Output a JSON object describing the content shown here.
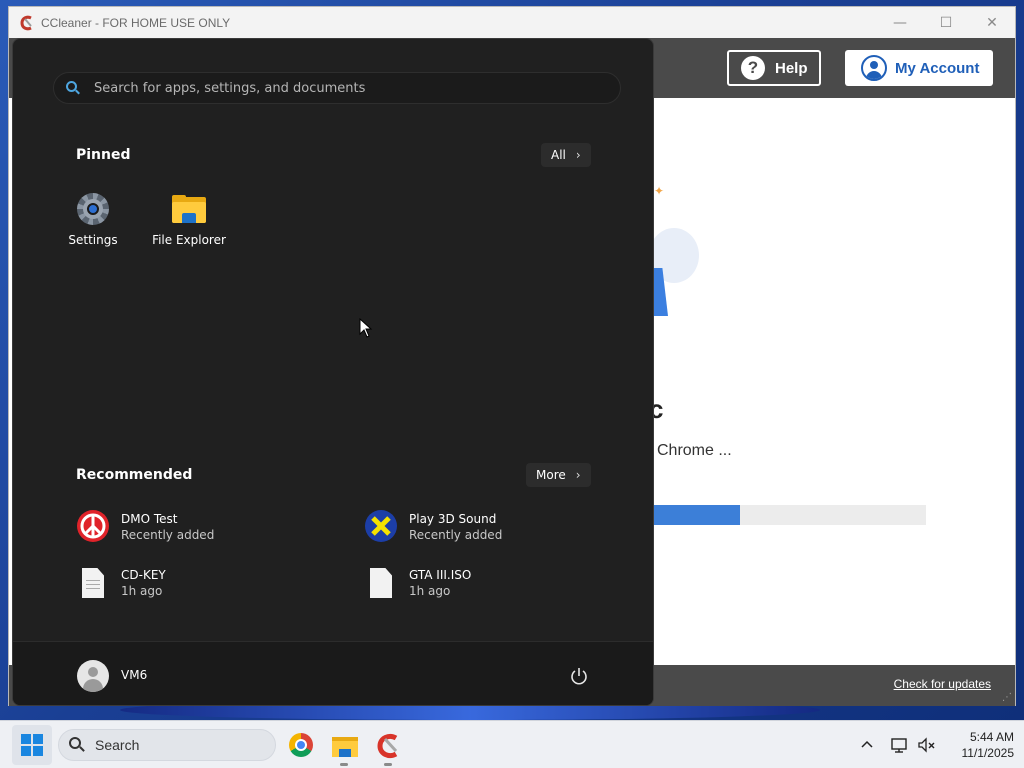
{
  "app_window": {
    "title": "CCleaner - FOR HOME USE ONLY",
    "controls": {
      "minimize": "—",
      "maximize": "☐",
      "close": "✕"
    },
    "header": {
      "help_label": "Help",
      "account_label": "My Account"
    },
    "content": {
      "partial_heading": "c",
      "status_text": "Chrome ...",
      "progress_fraction": 0.33
    },
    "footer": {
      "check_updates_label": "Check for updates"
    }
  },
  "start_menu": {
    "search_placeholder": "Search for apps, settings, and documents",
    "pinned": {
      "title": "Pinned",
      "all_label": "All",
      "apps": [
        {
          "label": "Settings",
          "icon": "gear-icon"
        },
        {
          "label": "File Explorer",
          "icon": "folder-icon"
        }
      ]
    },
    "recommended": {
      "title": "Recommended",
      "more_label": "More",
      "items": [
        {
          "name": "DMO Test",
          "sub": "Recently added",
          "icon": "peace-icon"
        },
        {
          "name": "Play 3D Sound",
          "sub": "Recently added",
          "icon": "x-app-icon"
        },
        {
          "name": "CD-KEY",
          "sub": "1h ago",
          "icon": "document-icon"
        },
        {
          "name": "GTA III.ISO",
          "sub": "1h ago",
          "icon": "document-icon"
        }
      ]
    },
    "user": {
      "name": "VM6"
    }
  },
  "taskbar": {
    "search_label": "Search",
    "apps": [
      "chrome-icon",
      "file-explorer-icon",
      "ccleaner-icon"
    ],
    "clock": {
      "time": "5:44 AM",
      "date": "11/1/2025"
    }
  },
  "colors": {
    "start_menu_bg": "#202020",
    "accent_blue": "#3c7fd8",
    "app_header": "#4a4a4a",
    "account_text": "#1f5fb8"
  }
}
